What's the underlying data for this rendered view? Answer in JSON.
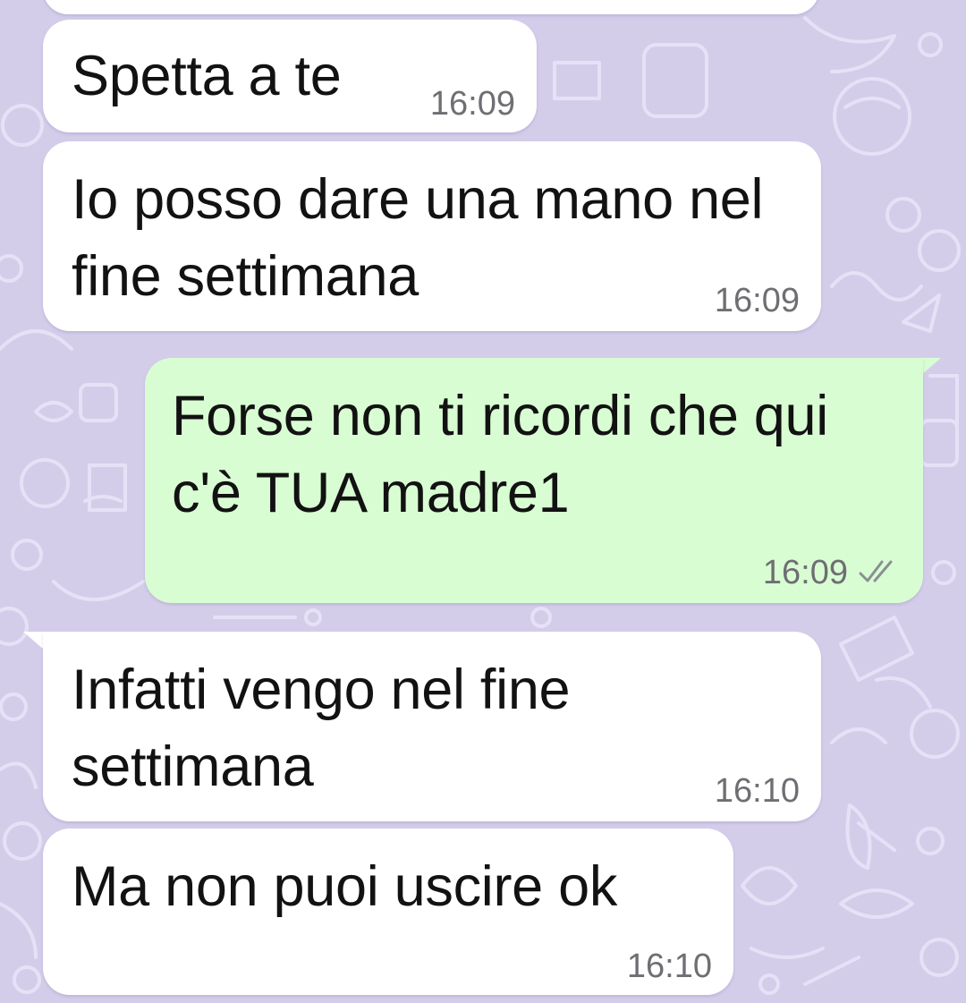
{
  "chat": {
    "background_color": "#d4cdea",
    "doodle_color": "#e6e1f6",
    "incoming_color": "#ffffff",
    "outgoing_color": "#d9fdd3",
    "messages": [
      {
        "direction": "incoming",
        "text": "Spetta a te",
        "time": "16:09"
      },
      {
        "direction": "incoming",
        "text": "Io posso dare una mano nel fine settimana",
        "time": "16:09"
      },
      {
        "direction": "outgoing",
        "text": "Forse non ti ricordi che qui c'è TUA madre1",
        "time": "16:09",
        "status_icon": "double-check-icon"
      },
      {
        "direction": "incoming",
        "text": "Infatti vengo nel fine settimana",
        "time": "16:10"
      },
      {
        "direction": "incoming",
        "text": "Ma non puoi uscire ok",
        "time": "16:10"
      }
    ]
  }
}
